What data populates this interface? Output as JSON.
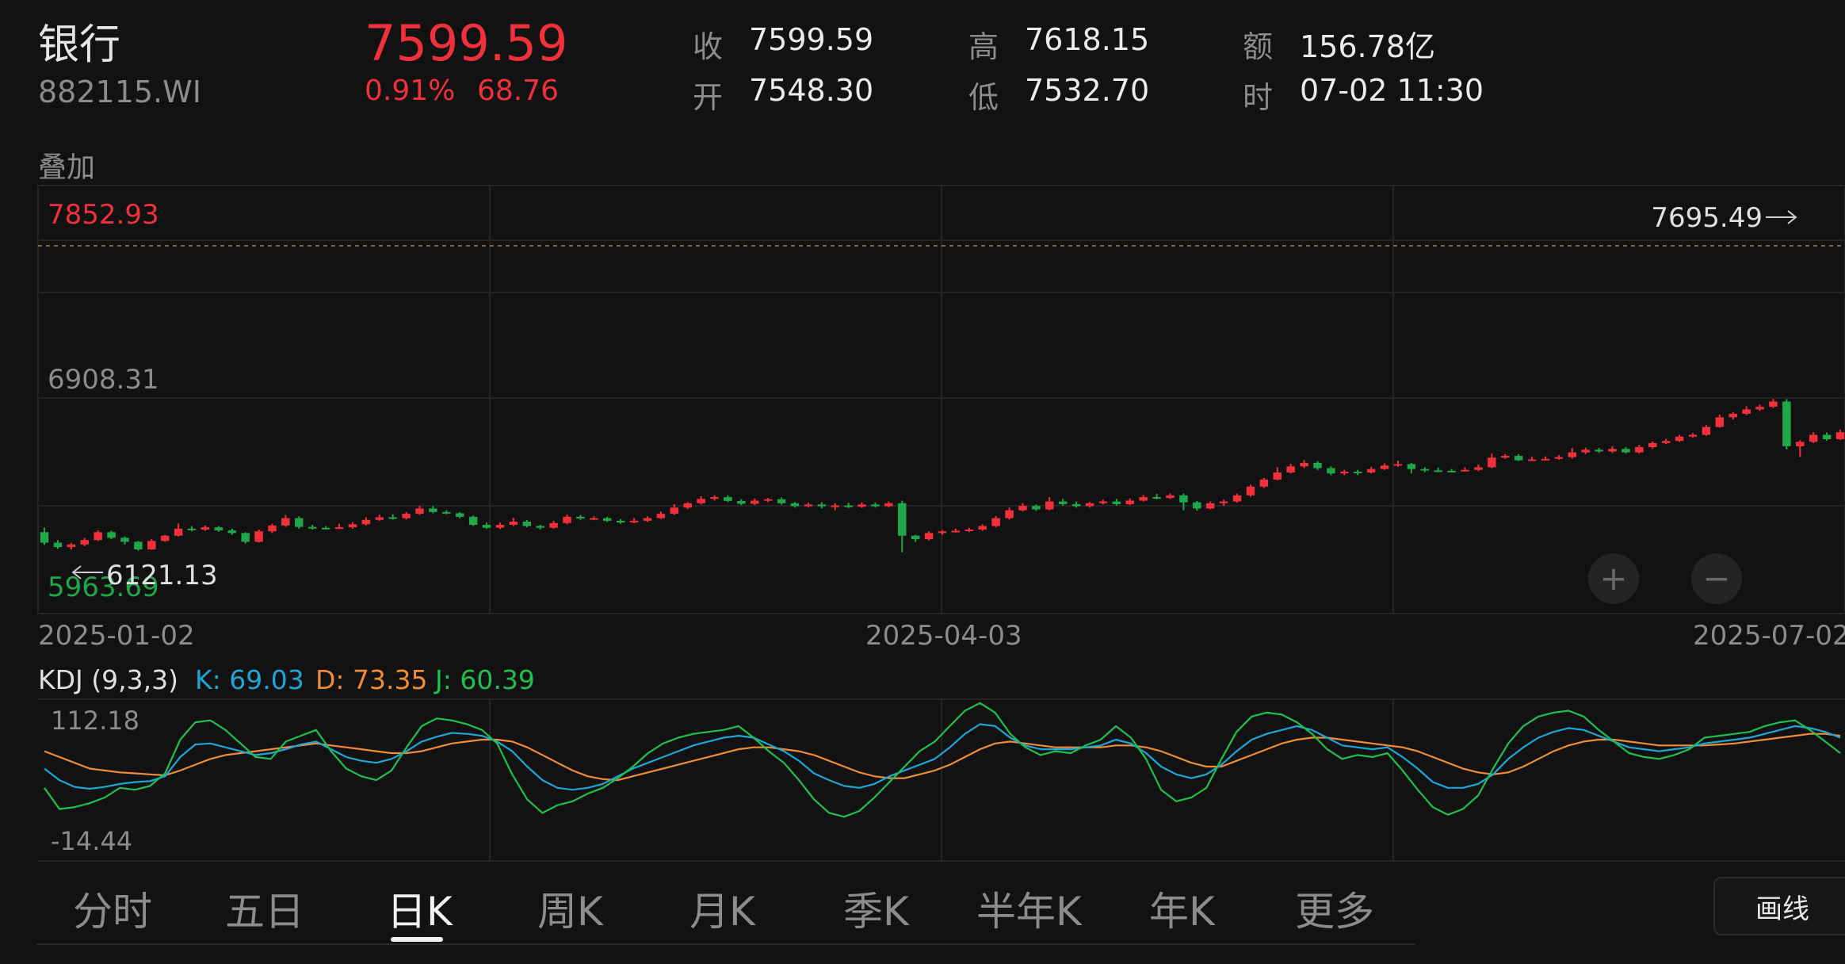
{
  "header": {
    "name": "银行",
    "code": "882115.WI",
    "price": "7599.59",
    "change_pct": "0.91%",
    "change_abs": "68.76"
  },
  "quote": {
    "close_label": "收",
    "close_value": "7599.59",
    "open_label": "开",
    "open_value": "7548.30",
    "high_label": "高",
    "high_value": "7618.15",
    "low_label": "低",
    "low_value": "7532.70",
    "amount_label": "额",
    "amount_value": "156.78亿",
    "time_label": "时",
    "time_value": "07-02 11:30"
  },
  "overlay_label": "叠加",
  "colors": {
    "up": "#f0313c",
    "down": "#1ea84a",
    "k_line": "#1ea6d8",
    "d_line": "#f08c35",
    "j_line": "#1ec04e",
    "grid": "#242424"
  },
  "chart_data": {
    "type": "candlestick",
    "y_axis": {
      "top_label": "7852.93",
      "mid_label": "6908.31",
      "bottom_label": "5963.69",
      "range": [
        5963.69,
        7852.93
      ]
    },
    "x_labels": [
      "2025-01-02",
      "2025-04-03",
      "2025-07-02"
    ],
    "annotations": {
      "max_value": "7695.49",
      "min_value": "6121.13"
    },
    "candles": [
      [
        6220,
        6160,
        6245,
        6148
      ],
      [
        6160,
        6135,
        6175,
        6125
      ],
      [
        6135,
        6150,
        6160,
        6121
      ],
      [
        6150,
        6175,
        6188,
        6140
      ],
      [
        6175,
        6220,
        6230,
        6170
      ],
      [
        6220,
        6188,
        6228,
        6180
      ],
      [
        6188,
        6165,
        6195,
        6150
      ],
      [
        6165,
        6122,
        6170,
        6115
      ],
      [
        6122,
        6170,
        6180,
        6120
      ],
      [
        6170,
        6200,
        6205,
        6165
      ],
      [
        6200,
        6240,
        6270,
        6195
      ],
      [
        6240,
        6235,
        6255,
        6225
      ],
      [
        6235,
        6248,
        6258,
        6228
      ],
      [
        6248,
        6230,
        6255,
        6222
      ],
      [
        6230,
        6215,
        6240,
        6205
      ],
      [
        6215,
        6165,
        6220,
        6155
      ],
      [
        6165,
        6225,
        6235,
        6160
      ],
      [
        6225,
        6258,
        6268,
        6215
      ],
      [
        6258,
        6300,
        6318,
        6250
      ],
      [
        6300,
        6250,
        6310,
        6240
      ],
      [
        6250,
        6245,
        6262,
        6235
      ],
      [
        6245,
        6243,
        6255,
        6235
      ],
      [
        6243,
        6248,
        6268,
        6238
      ],
      [
        6248,
        6265,
        6278,
        6240
      ],
      [
        6265,
        6290,
        6305,
        6258
      ],
      [
        6290,
        6305,
        6320,
        6285
      ],
      [
        6305,
        6300,
        6322,
        6292
      ],
      [
        6300,
        6325,
        6335,
        6292
      ],
      [
        6325,
        6355,
        6370,
        6318
      ],
      [
        6355,
        6335,
        6368,
        6328
      ],
      [
        6335,
        6328,
        6345,
        6322
      ],
      [
        6328,
        6308,
        6335,
        6298
      ],
      [
        6308,
        6262,
        6315,
        6255
      ],
      [
        6262,
        6245,
        6275,
        6238
      ],
      [
        6245,
        6262,
        6275,
        6238
      ],
      [
        6262,
        6280,
        6302,
        6255
      ],
      [
        6280,
        6255,
        6290,
        6248
      ],
      [
        6255,
        6245,
        6262,
        6235
      ],
      [
        6245,
        6272,
        6285,
        6240
      ],
      [
        6272,
        6308,
        6320,
        6265
      ],
      [
        6308,
        6298,
        6318,
        6290
      ],
      [
        6298,
        6300,
        6310,
        6288
      ],
      [
        6300,
        6285,
        6308,
        6278
      ],
      [
        6285,
        6275,
        6295,
        6268
      ],
      [
        6275,
        6285,
        6300,
        6270
      ],
      [
        6285,
        6300,
        6310,
        6278
      ],
      [
        6300,
        6325,
        6338,
        6295
      ],
      [
        6325,
        6360,
        6380,
        6318
      ],
      [
        6360,
        6385,
        6392,
        6352
      ],
      [
        6385,
        6410,
        6425,
        6378
      ],
      [
        6410,
        6420,
        6430,
        6400
      ],
      [
        6420,
        6398,
        6430,
        6392
      ],
      [
        6398,
        6382,
        6408,
        6375
      ],
      [
        6382,
        6400,
        6412,
        6375
      ],
      [
        6400,
        6408,
        6415,
        6392
      ],
      [
        6408,
        6385,
        6418,
        6378
      ],
      [
        6385,
        6368,
        6392,
        6360
      ],
      [
        6368,
        6378,
        6388,
        6362
      ],
      [
        6378,
        6368,
        6390,
        6355
      ],
      [
        6368,
        6372,
        6385,
        6345
      ],
      [
        6372,
        6365,
        6388,
        6358
      ],
      [
        6365,
        6378,
        6390,
        6358
      ],
      [
        6378,
        6368,
        6388,
        6360
      ],
      [
        6368,
        6385,
        6395,
        6362
      ],
      [
        6385,
        6200,
        6400,
        6105
      ],
      [
        6200,
        6180,
        6205,
        6165
      ],
      [
        6180,
        6215,
        6225,
        6172
      ],
      [
        6215,
        6225,
        6232,
        6205
      ],
      [
        6225,
        6228,
        6240,
        6218
      ],
      [
        6228,
        6235,
        6245,
        6220
      ],
      [
        6235,
        6255,
        6265,
        6228
      ],
      [
        6255,
        6300,
        6312,
        6248
      ],
      [
        6300,
        6345,
        6360,
        6292
      ],
      [
        6345,
        6370,
        6385,
        6338
      ],
      [
        6370,
        6350,
        6378,
        6342
      ],
      [
        6350,
        6395,
        6420,
        6345
      ],
      [
        6395,
        6380,
        6410,
        6372
      ],
      [
        6380,
        6368,
        6395,
        6360
      ],
      [
        6368,
        6385,
        6392,
        6360
      ],
      [
        6385,
        6395,
        6405,
        6378
      ],
      [
        6395,
        6380,
        6410,
        6372
      ],
      [
        6380,
        6400,
        6412,
        6375
      ],
      [
        6400,
        6420,
        6432,
        6395
      ],
      [
        6420,
        6415,
        6438,
        6408
      ],
      [
        6415,
        6430,
        6440,
        6410
      ],
      [
        6430,
        6390,
        6440,
        6345
      ],
      [
        6390,
        6355,
        6398,
        6342
      ],
      [
        6355,
        6385,
        6395,
        6350
      ],
      [
        6385,
        6395,
        6405,
        6370
      ],
      [
        6395,
        6430,
        6440,
        6388
      ],
      [
        6430,
        6480,
        6490,
        6422
      ],
      [
        6480,
        6520,
        6530,
        6472
      ],
      [
        6520,
        6560,
        6590,
        6515
      ],
      [
        6560,
        6595,
        6610,
        6555
      ],
      [
        6595,
        6615,
        6630,
        6585
      ],
      [
        6615,
        6585,
        6625,
        6575
      ],
      [
        6585,
        6555,
        6595,
        6545
      ],
      [
        6555,
        6565,
        6575,
        6545
      ],
      [
        6565,
        6560,
        6575,
        6545
      ],
      [
        6560,
        6580,
        6592,
        6555
      ],
      [
        6580,
        6600,
        6612,
        6575
      ],
      [
        6600,
        6608,
        6628,
        6592
      ],
      [
        6608,
        6580,
        6615,
        6555
      ],
      [
        6580,
        6572,
        6590,
        6562
      ],
      [
        6572,
        6570,
        6588,
        6562
      ],
      [
        6570,
        6568,
        6580,
        6560
      ],
      [
        6568,
        6575,
        6590,
        6565
      ],
      [
        6575,
        6590,
        6605,
        6568
      ],
      [
        6590,
        6645,
        6668,
        6585
      ],
      [
        6645,
        6655,
        6665,
        6638
      ],
      [
        6655,
        6630,
        6665,
        6625
      ],
      [
        6630,
        6635,
        6650,
        6625
      ],
      [
        6635,
        6638,
        6652,
        6628
      ],
      [
        6638,
        6648,
        6660,
        6632
      ],
      [
        6648,
        6675,
        6700,
        6640
      ],
      [
        6675,
        6690,
        6702,
        6665
      ],
      [
        6690,
        6680,
        6700,
        6672
      ],
      [
        6680,
        6695,
        6710,
        6672
      ],
      [
        6695,
        6675,
        6705,
        6668
      ],
      [
        6675,
        6705,
        6718,
        6668
      ],
      [
        6705,
        6728,
        6738,
        6695
      ],
      [
        6728,
        6740,
        6752,
        6722
      ],
      [
        6740,
        6765,
        6775,
        6735
      ],
      [
        6765,
        6775,
        6785,
        6758
      ],
      [
        6775,
        6820,
        6830,
        6770
      ],
      [
        6820,
        6875,
        6890,
        6815
      ],
      [
        6875,
        6895,
        6905,
        6862
      ],
      [
        6895,
        6920,
        6938,
        6888
      ],
      [
        6920,
        6935,
        6948,
        6912
      ],
      [
        6935,
        6965,
        6980,
        6928
      ],
      [
        6965,
        6710,
        6979,
        6692
      ],
      [
        6710,
        6735,
        6745,
        6648
      ],
      [
        6735,
        6775,
        6790,
        6728
      ],
      [
        6775,
        6750,
        6788,
        6742
      ],
      [
        6750,
        6790,
        6805,
        6745
      ]
    ]
  },
  "kdj": {
    "label": "KDJ (9,3,3)",
    "k_label": "K: 69.03",
    "d_label": "D: 73.35",
    "j_label": "J: 60.39",
    "top_label": "112.18",
    "bottom_label": "-14.44",
    "range": [
      -14.44,
      112.18
    ],
    "k": [
      60,
      48,
      41,
      39,
      41,
      44,
      46,
      47,
      52,
      72,
      85,
      86,
      82,
      78,
      74,
      76,
      80,
      85,
      88,
      80,
      72,
      68,
      66,
      70,
      78,
      88,
      93,
      97,
      96,
      94,
      88,
      78,
      62,
      48,
      40,
      38,
      40,
      44,
      52,
      60,
      66,
      72,
      78,
      84,
      88,
      92,
      94,
      92,
      85,
      78,
      68,
      55,
      48,
      42,
      40,
      44,
      52,
      58,
      64,
      70,
      82,
      96,
      106,
      104,
      92,
      84,
      80,
      80,
      80,
      82,
      84,
      90,
      86,
      76,
      62,
      54,
      50,
      54,
      64,
      78,
      90,
      96,
      100,
      104,
      100,
      92,
      84,
      82,
      80,
      82,
      72,
      60,
      46,
      40,
      40,
      44,
      54,
      70,
      82,
      92,
      98,
      102,
      100,
      94,
      88,
      82,
      80,
      78,
      80,
      82,
      86,
      88,
      90,
      92,
      96,
      100,
      104,
      102,
      98,
      92
    ],
    "d": [
      78,
      72,
      66,
      60,
      58,
      56,
      55,
      54,
      53,
      58,
      64,
      70,
      74,
      76,
      78,
      80,
      82,
      84,
      86,
      84,
      82,
      80,
      78,
      76,
      76,
      78,
      82,
      86,
      88,
      90,
      90,
      88,
      82,
      74,
      66,
      58,
      52,
      49,
      48,
      52,
      56,
      60,
      64,
      68,
      72,
      76,
      80,
      82,
      82,
      80,
      78,
      74,
      68,
      62,
      56,
      52,
      50,
      50,
      54,
      58,
      64,
      72,
      80,
      86,
      88,
      86,
      84,
      82,
      82,
      82,
      82,
      84,
      84,
      82,
      78,
      72,
      66,
      62,
      62,
      68,
      74,
      80,
      86,
      90,
      92,
      92,
      90,
      88,
      86,
      84,
      82,
      78,
      72,
      66,
      60,
      56,
      54,
      56,
      62,
      70,
      78,
      84,
      88,
      90,
      90,
      88,
      86,
      84,
      84,
      84,
      84,
      85,
      86,
      88,
      90,
      92,
      94,
      96,
      96,
      94
    ],
    "j": [
      40,
      18,
      20,
      24,
      30,
      40,
      38,
      42,
      55,
      90,
      108,
      110,
      100,
      86,
      72,
      70,
      88,
      94,
      100,
      78,
      60,
      52,
      48,
      58,
      82,
      104,
      112,
      110,
      106,
      100,
      86,
      54,
      28,
      14,
      22,
      26,
      34,
      40,
      50,
      62,
      76,
      86,
      92,
      96,
      98,
      100,
      104,
      92,
      78,
      66,
      48,
      28,
      14,
      10,
      16,
      30,
      46,
      62,
      78,
      88,
      104,
      120,
      128,
      118,
      96,
      82,
      74,
      78,
      76,
      84,
      90,
      104,
      92,
      70,
      38,
      26,
      30,
      40,
      70,
      98,
      114,
      118,
      116,
      108,
      96,
      80,
      70,
      74,
      72,
      76,
      58,
      38,
      20,
      12,
      18,
      32,
      60,
      86,
      104,
      114,
      118,
      120,
      114,
      100,
      88,
      76,
      72,
      70,
      74,
      80,
      92,
      94,
      96,
      98,
      104,
      108,
      110,
      100,
      88,
      76
    ]
  },
  "zoom": {
    "zoom_in": "+",
    "zoom_out": "−"
  },
  "tabs": [
    "分时",
    "五日",
    "日K",
    "周K",
    "月K",
    "季K",
    "半年K",
    "年K",
    "更多"
  ],
  "active_tab": "日K",
  "draw_button": "画线"
}
